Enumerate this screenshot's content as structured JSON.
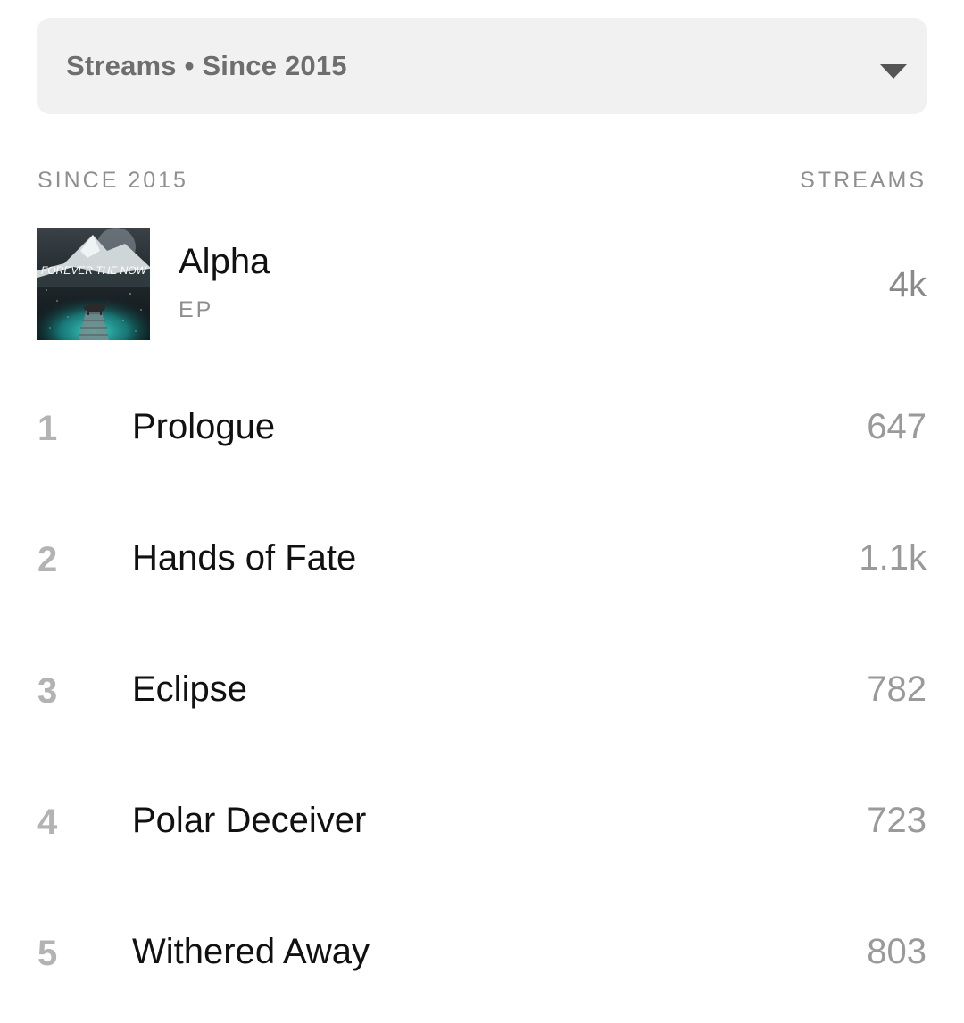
{
  "filter": {
    "label": "Streams • Since 2015",
    "caret_icon": "chevron-down-icon"
  },
  "columns": {
    "left": "SINCE 2015",
    "right": "STREAMS"
  },
  "album": {
    "title": "Alpha",
    "type": "EP",
    "streams": "4k",
    "cover_text": "FOREVER THE NOW"
  },
  "tracks": [
    {
      "number": "1",
      "title": "Prologue",
      "streams": "647"
    },
    {
      "number": "2",
      "title": "Hands of Fate",
      "streams": "1.1k"
    },
    {
      "number": "3",
      "title": "Eclipse",
      "streams": "782"
    },
    {
      "number": "4",
      "title": "Polar Deceiver",
      "streams": "723"
    },
    {
      "number": "5",
      "title": "Withered Away",
      "streams": "803"
    }
  ]
}
